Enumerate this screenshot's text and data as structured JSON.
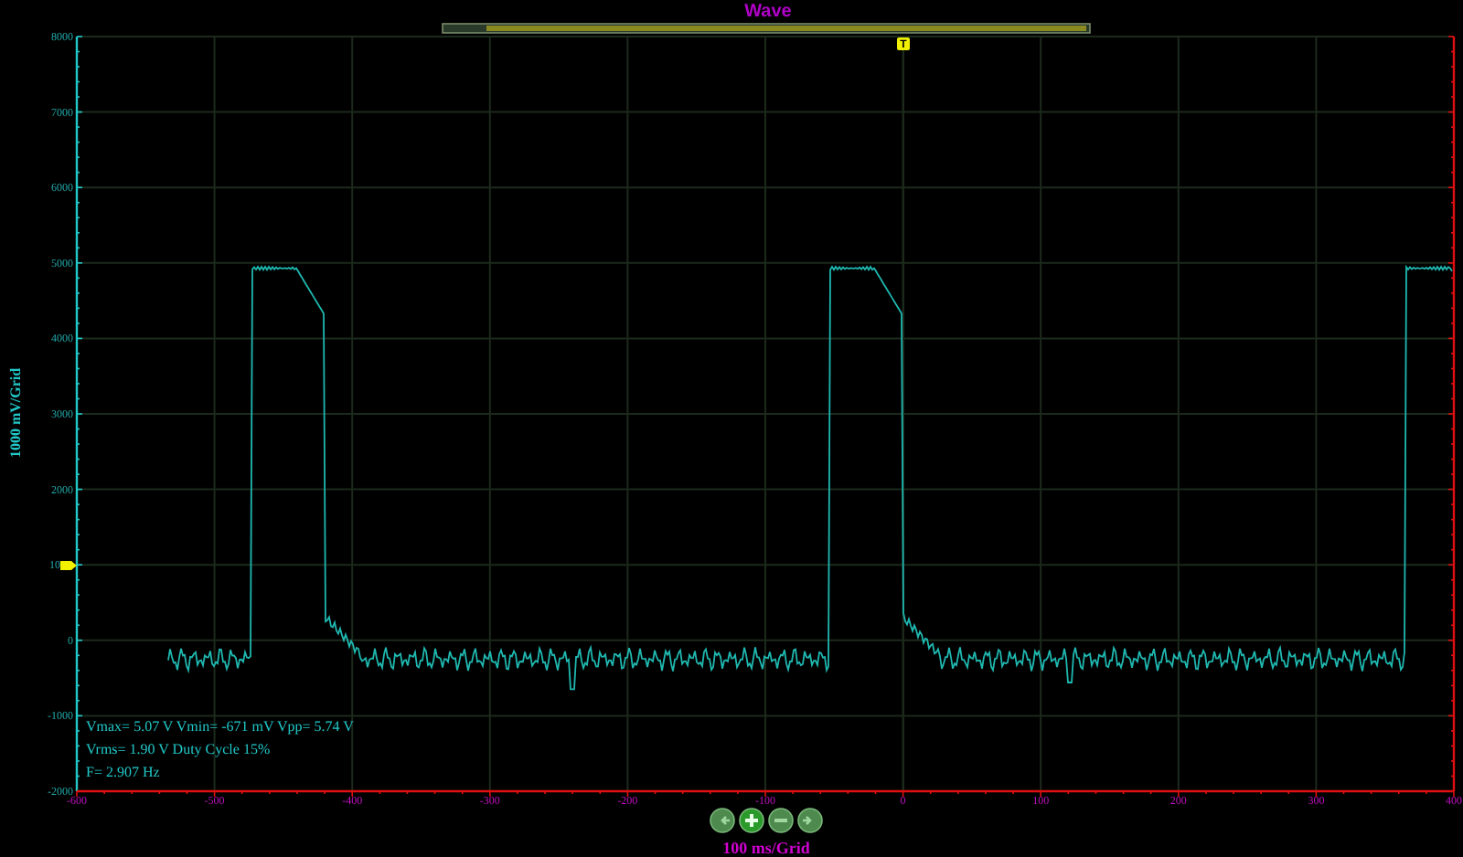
{
  "title": "Wave",
  "trigger_marker": "T",
  "y_axis": {
    "label": "1000 mV/Grid",
    "ticks": [
      "8000",
      "7000",
      "6000",
      "5000",
      "4000",
      "3000",
      "2000",
      "10",
      "0",
      "-1000",
      "-2000"
    ]
  },
  "x_axis": {
    "label": "100 ms/Grid",
    "ticks": [
      "-600",
      "-500",
      "-400",
      "-300",
      "-200",
      "-100",
      "0",
      "100",
      "200",
      "300",
      "400"
    ]
  },
  "measurements": [
    "Vmax= 5.07 V  Vmin= -671 mV  Vpp= 5.74 V",
    "Vrms= 1.90 V  Duty Cycle 15%",
    "F= 2.907 Hz"
  ],
  "zoom_buttons": [
    {
      "kind": "left"
    },
    {
      "kind": "plus"
    },
    {
      "kind": "minus"
    },
    {
      "kind": "right"
    }
  ]
}
